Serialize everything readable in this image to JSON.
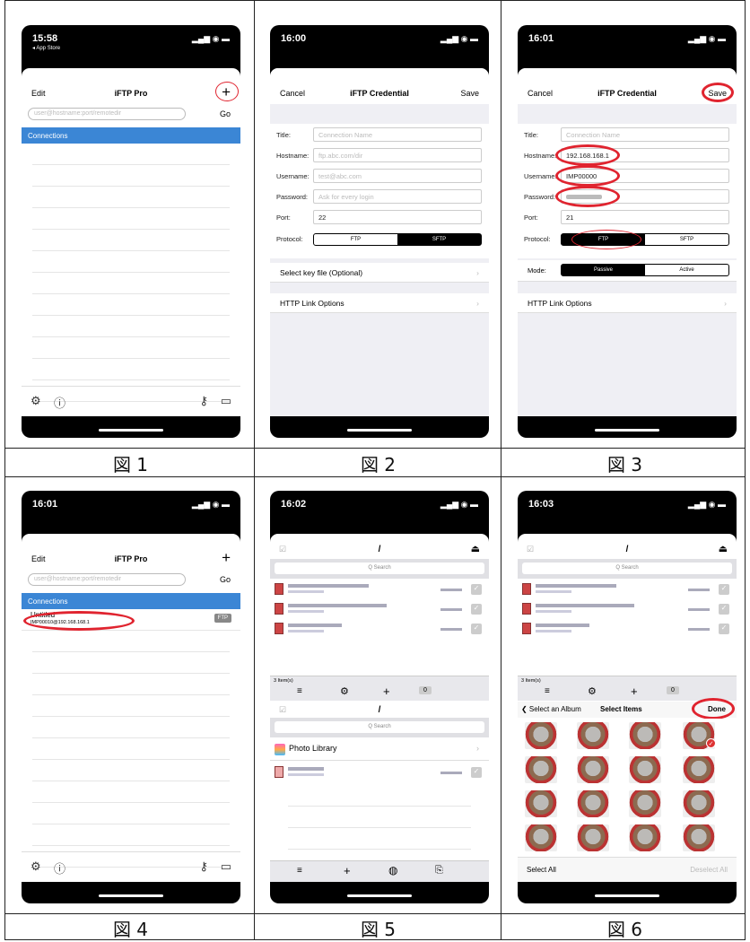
{
  "captions": [
    "図 1",
    "図 2",
    "図 3",
    "図 4",
    "図 5",
    "図 6"
  ],
  "screens": {
    "s1": {
      "time": "15:58",
      "back": "◂ App Store",
      "edit": "Edit",
      "title": "iFTP Pro",
      "plus": "+",
      "placeholder": "user@hostname:port/remotedir",
      "go": "Go",
      "connections": "Connections",
      "gear": "⚙",
      "info": "ⓘ",
      "key": "⚷",
      "folder": "▭"
    },
    "s2": {
      "time": "16:00",
      "cancel": "Cancel",
      "title": "iFTP Credential",
      "save": "Save",
      "fields": [
        {
          "label": "Title:",
          "value": "Connection Name",
          "ph": true
        },
        {
          "label": "Hostname:",
          "value": "ftp.abc.com/dir",
          "ph": true
        },
        {
          "label": "Username:",
          "value": "test@abc.com",
          "ph": true
        },
        {
          "label": "Password:",
          "value": "Ask for every login",
          "ph": true
        },
        {
          "label": "Port:",
          "value": "22",
          "ph": false
        }
      ],
      "protocol_label": "Protocol:",
      "proto_a": "FTP",
      "proto_b": "SFTP",
      "key_file": "Select key file (Optional)",
      "http": "HTTP Link Options",
      "chevron": "›"
    },
    "s3": {
      "time": "16:01",
      "cancel": "Cancel",
      "title": "iFTP Credential",
      "save": "Save",
      "fields": [
        {
          "label": "Title:",
          "value": "Connection Name",
          "ph": true
        },
        {
          "label": "Hostname:",
          "value": "192.168.168.1",
          "ph": false
        },
        {
          "label": "Username:",
          "value": "IMP00000",
          "ph": false
        },
        {
          "label": "Password:",
          "value": "",
          "ph": false
        },
        {
          "label": "Port:",
          "value": "21",
          "ph": false
        }
      ],
      "protocol_label": "Protocol:",
      "proto_a": "FTP",
      "proto_b": "SFTP",
      "mode_label": "Mode:",
      "mode_a": "Passive",
      "mode_b": "Active",
      "http": "HTTP Link Options",
      "chevron": "›"
    },
    "s4": {
      "time": "16:01",
      "edit": "Edit",
      "title": "iFTP Pro",
      "plus": "+",
      "placeholder": "user@hostname:port/remotedir",
      "go": "Go",
      "connections": "Connections",
      "item_title": "Untitled",
      "item_sub": "IMP00010@192.168.168.1",
      "badge": "FTP"
    },
    "s5": {
      "time": "16:02",
      "path": "/",
      "search": "Q Search",
      "count": "3 Item(s)",
      "zero": "0",
      "photo": "Photo Library",
      "path2": "/"
    },
    "s6": {
      "time": "16:03",
      "path": "/",
      "search": "Q Search",
      "count": "3 Item(s)",
      "zero": "0",
      "back": "❮ Select an Album",
      "select": "Select Items",
      "done": "Done",
      "select_all": "Select All",
      "deselect_all": "Deselect All"
    }
  }
}
